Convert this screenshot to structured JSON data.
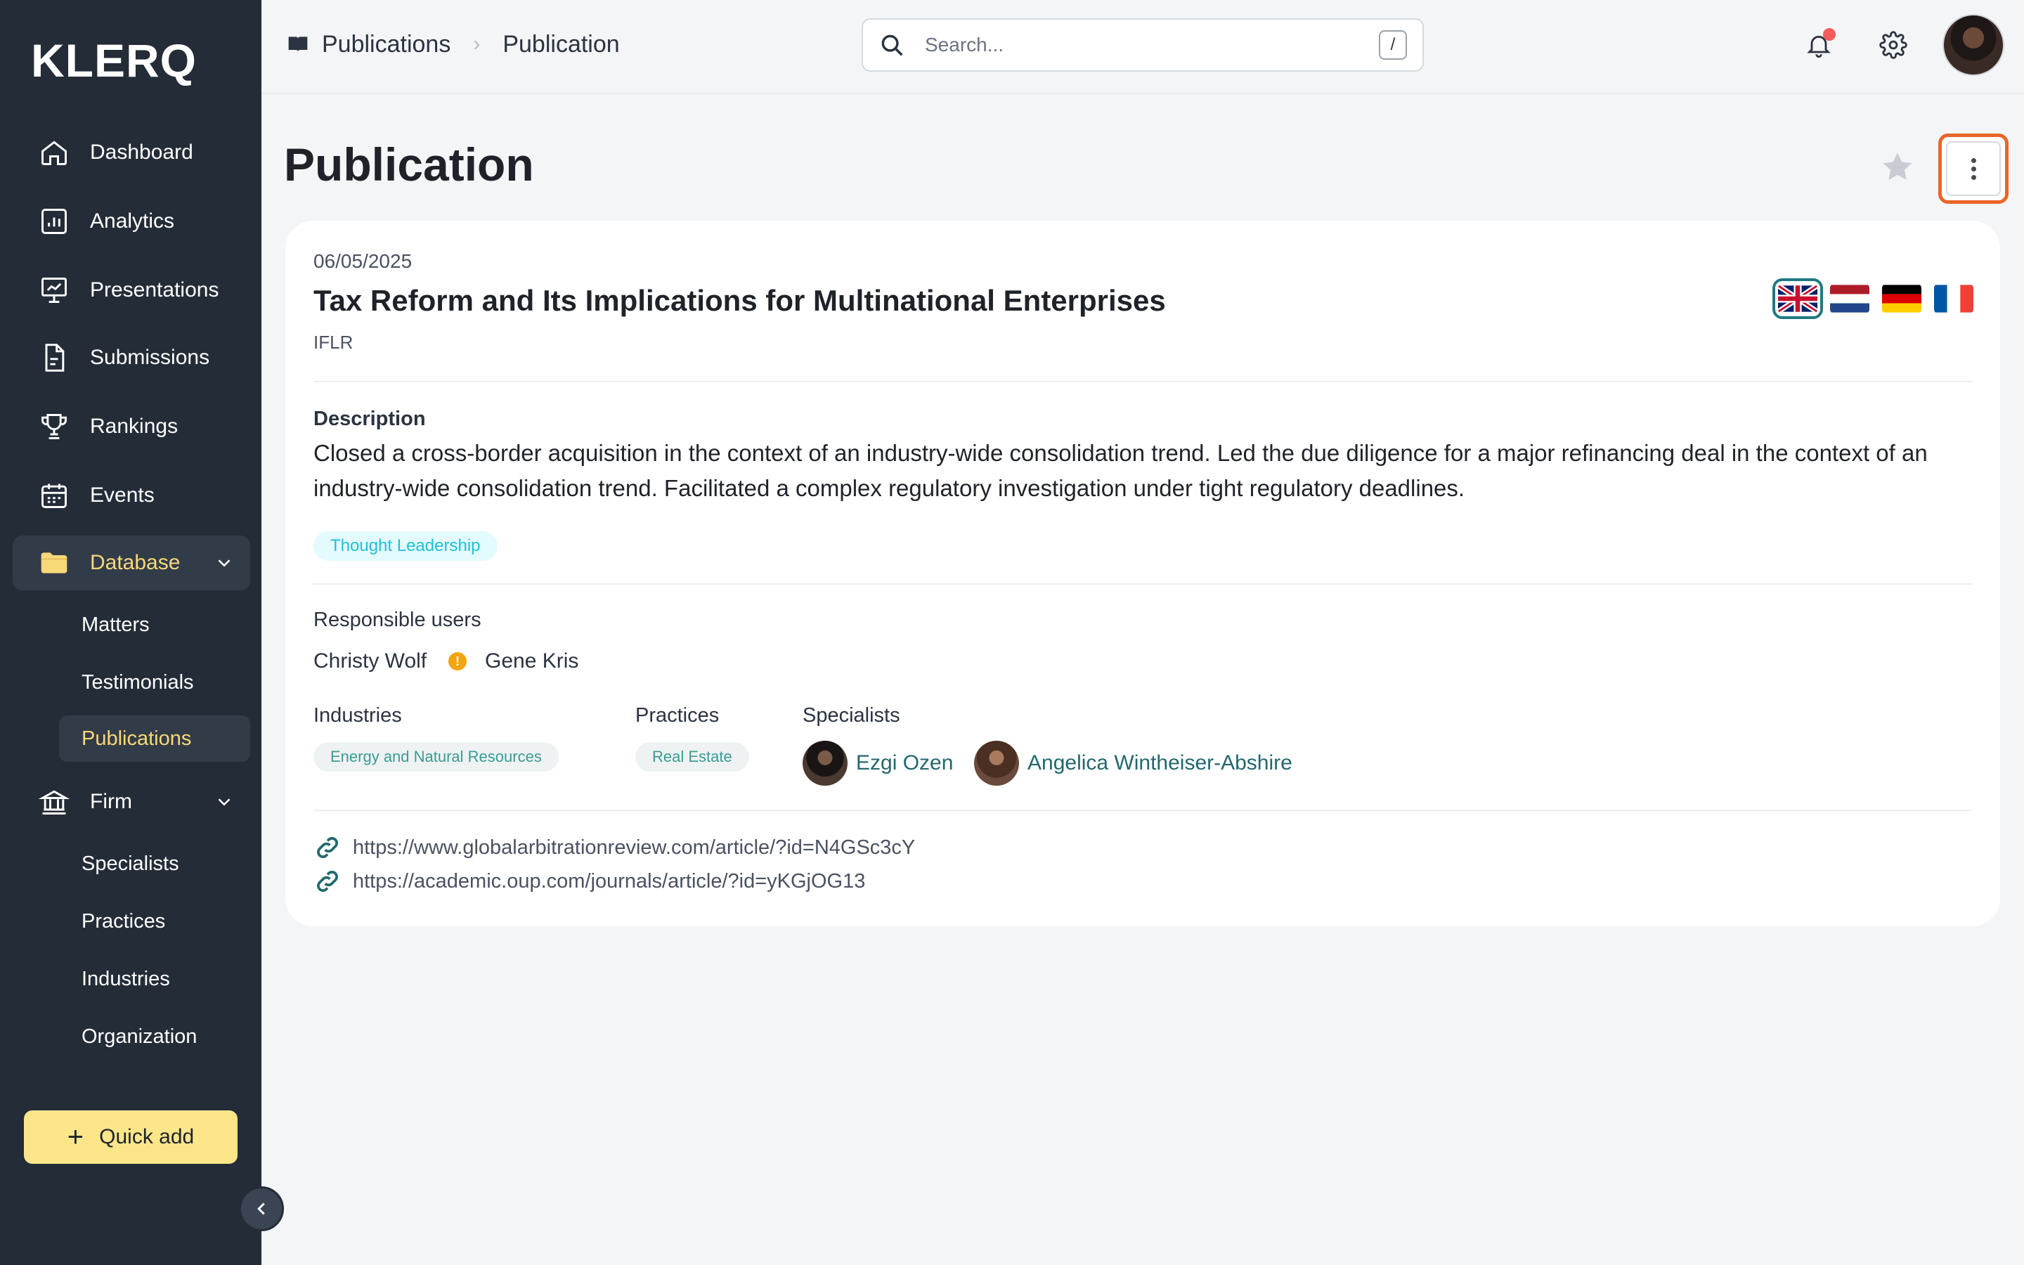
{
  "app": {
    "logo": "KLERQ"
  },
  "sidebar": {
    "items": [
      {
        "label": "Dashboard",
        "icon": "home-icon"
      },
      {
        "label": "Analytics",
        "icon": "bar-chart-icon"
      },
      {
        "label": "Presentations",
        "icon": "presentation-icon"
      },
      {
        "label": "Submissions",
        "icon": "document-icon"
      },
      {
        "label": "Rankings",
        "icon": "trophy-icon"
      },
      {
        "label": "Events",
        "icon": "calendar-icon"
      },
      {
        "label": "Database",
        "icon": "folder-icon",
        "expanded": true,
        "active": true
      },
      {
        "label": "Firm",
        "icon": "bank-icon",
        "expanded": true
      }
    ],
    "database_sub": [
      "Matters",
      "Testimonials",
      "Publications"
    ],
    "firm_sub": [
      "Specialists",
      "Practices",
      "Industries",
      "Organization"
    ],
    "active_sub": "Publications",
    "quick_add": "Quick add",
    "accent_color": "#f8d878"
  },
  "topbar": {
    "breadcrumb": [
      "Publications",
      "Publication"
    ],
    "search_placeholder": "Search...",
    "search_shortcut": "/",
    "has_notification": true
  },
  "page": {
    "title": "Publication"
  },
  "publication": {
    "date": "06/05/2025",
    "title": "Tax Reform and Its Implications for Multinational Enterprises",
    "source": "IFLR",
    "languages": [
      "en",
      "nl",
      "de",
      "fr"
    ],
    "selected_language": "en",
    "description_label": "Description",
    "description": "Closed a cross-border acquisition in the context of an industry-wide consolidation trend. Led the due diligence for a major refinancing deal in the context of an industry-wide consolidation trend. Facilitated a complex regulatory investigation under tight regulatory deadlines.",
    "category_tag": "Thought Leadership",
    "responsible_label": "Responsible users",
    "responsible_users": [
      "Christy Wolf",
      "Gene Kris"
    ],
    "warning_marker": "!",
    "industries_label": "Industries",
    "industries": [
      "Energy and Natural Resources"
    ],
    "practices_label": "Practices",
    "practices": [
      "Real Estate"
    ],
    "specialists_label": "Specialists",
    "specialists": [
      "Ezgi Ozen",
      "Angelica Wintheiser-Abshire"
    ],
    "links": [
      "https://www.globalarbitrationreview.com/article/?id=N4GSc3cY",
      "https://academic.oup.com/journals/article/?id=yKGjOG13"
    ]
  }
}
